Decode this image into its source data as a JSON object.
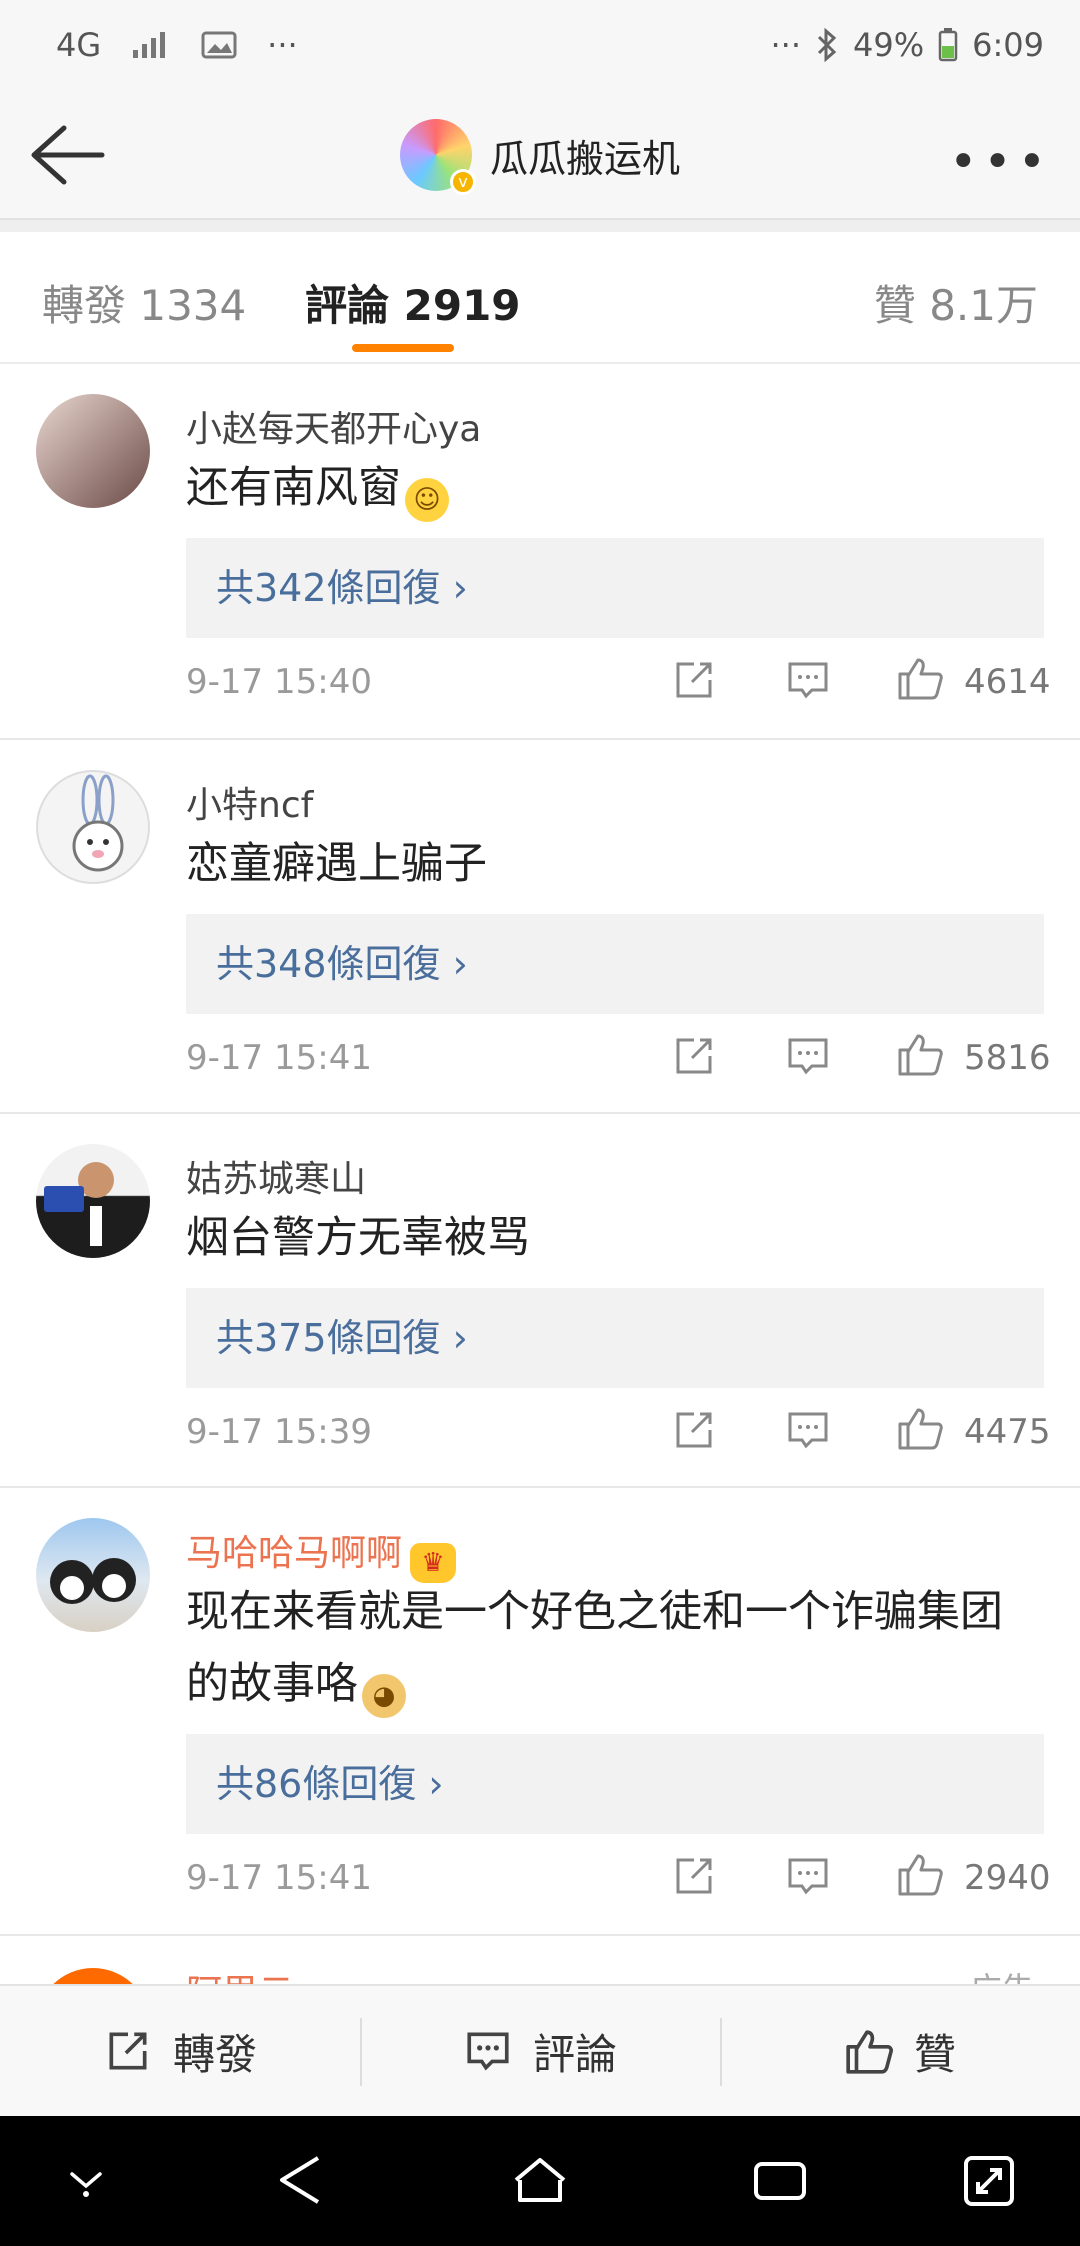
{
  "status_bar": {
    "network": "4G",
    "battery": "49%",
    "time": "6:09",
    "dots_left": "···",
    "dots_right": "···"
  },
  "header": {
    "title": "瓜瓜搬运机",
    "verified_mark": "v"
  },
  "tabs": [
    {
      "label": "轉發 1334"
    },
    {
      "label": "評論 2919"
    },
    {
      "label": "贊 8.1万"
    }
  ],
  "comments": [
    {
      "user": "小赵每天都开心ya",
      "text": "还有南风窗",
      "emoji": "smile",
      "replies": "共342條回復 ›",
      "time": "9-17 15:40",
      "likes": "4614"
    },
    {
      "user": "小特ncf",
      "text": "恋童癖遇上骗子",
      "replies": "共348條回復 ›",
      "time": "9-17 15:41",
      "likes": "5816"
    },
    {
      "user": "姑苏城寒山",
      "text": "烟台警方无辜被骂",
      "replies": "共375條回復 ›",
      "time": "9-17 15:39",
      "likes": "4475"
    },
    {
      "user": "马哈哈马啊啊",
      "text_line1": "现在来看就是一个好色之徒和一个诈骗集团",
      "text_line2": "的故事咯",
      "emoji": "doge",
      "replies": "共86條回復 ›",
      "time": "9-17 15:41",
      "likes": "2940",
      "vip": true
    }
  ],
  "partial_comment": {
    "user": "阿里云",
    "tag": "广告"
  },
  "bottom_bar": {
    "repost": "轉發",
    "comment": "評論",
    "like": "贊"
  },
  "colors": {
    "accent": "#ff8200",
    "link": "#4a6e9c",
    "vip_name": "#eb7350"
  },
  "icons": [
    "back-arrow-icon",
    "more-icon",
    "repost-icon",
    "comment-icon",
    "like-icon",
    "crown-icon",
    "smile-emoji-icon",
    "doge-emoji-icon"
  ]
}
